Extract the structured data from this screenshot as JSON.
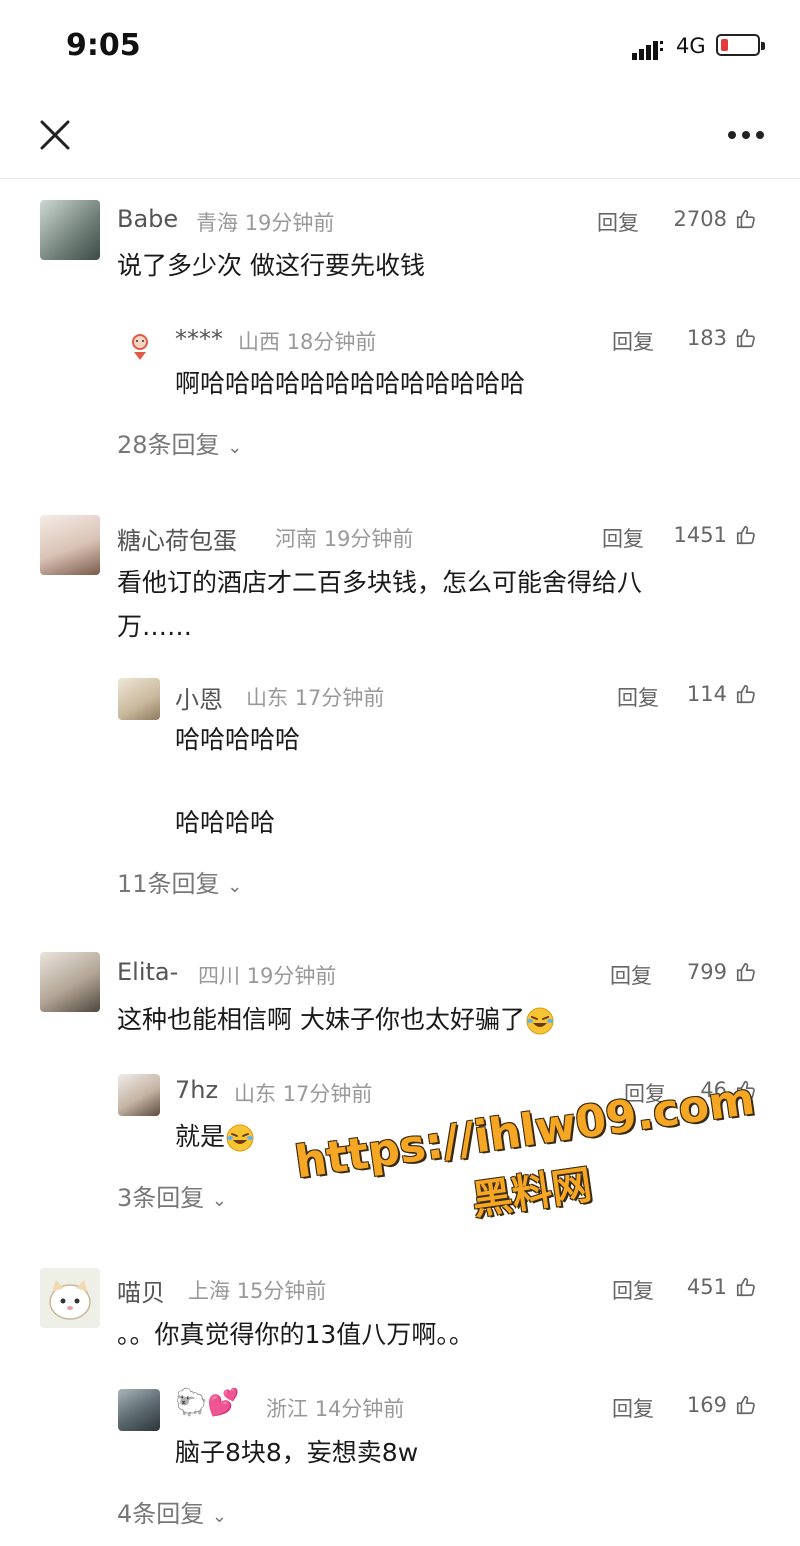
{
  "status_bar": {
    "time": "9:05",
    "network": "4G",
    "battery_level": 0.2
  },
  "nav": {
    "close_icon": "close-icon",
    "more_icon": "more-icon"
  },
  "comments": [
    {
      "name": "Babe",
      "region": "青海",
      "time": "19分钟前",
      "reply_label": "回复",
      "likes": "2708",
      "text": "说了多少次 做这行要先收钱",
      "sub_reply": {
        "name": "****",
        "region": "山西",
        "time": "18分钟前",
        "reply_label": "回复",
        "likes": "183",
        "text": "啊哈哈哈哈哈哈哈哈哈哈哈哈哈"
      },
      "more_replies": "28条回复"
    },
    {
      "name": "糖心荷包蛋",
      "region": "河南",
      "time": "19分钟前",
      "reply_label": "回复",
      "likes": "1451",
      "text_line1": "看他订的酒店才二百多块钱，怎么可能舍得给八",
      "text_line2": "万……",
      "sub_reply": {
        "name": "小恩",
        "region": "山东",
        "time": "17分钟前",
        "reply_label": "回复",
        "likes": "114",
        "text_line1": "哈哈哈哈哈",
        "text_line2": "哈哈哈哈"
      },
      "more_replies": "11条回复"
    },
    {
      "name": "Elita-",
      "region": "四川",
      "time": "19分钟前",
      "reply_label": "回复",
      "likes": "799",
      "text": "这种也能相信啊 大妹子你也太好骗了",
      "sub_reply": {
        "name": "7hz",
        "region": "山东",
        "time": "17分钟前",
        "reply_label": "回复",
        "likes": "46",
        "text": "就是"
      },
      "more_replies": "3条回复"
    },
    {
      "name": "喵贝",
      "region": "上海",
      "time": "15分钟前",
      "reply_label": "回复",
      "likes": "451",
      "text": "。。你真觉得你的13值八万啊。。",
      "sub_reply": {
        "name": "🐑💕",
        "region": "浙江",
        "time": "14分钟前",
        "reply_label": "回复",
        "likes": "169",
        "text": "脑子8块8，妄想卖8w"
      },
      "more_replies": "4条回复"
    }
  ],
  "watermark": {
    "url": "https://ihlw09.com",
    "label": "黑料网"
  }
}
